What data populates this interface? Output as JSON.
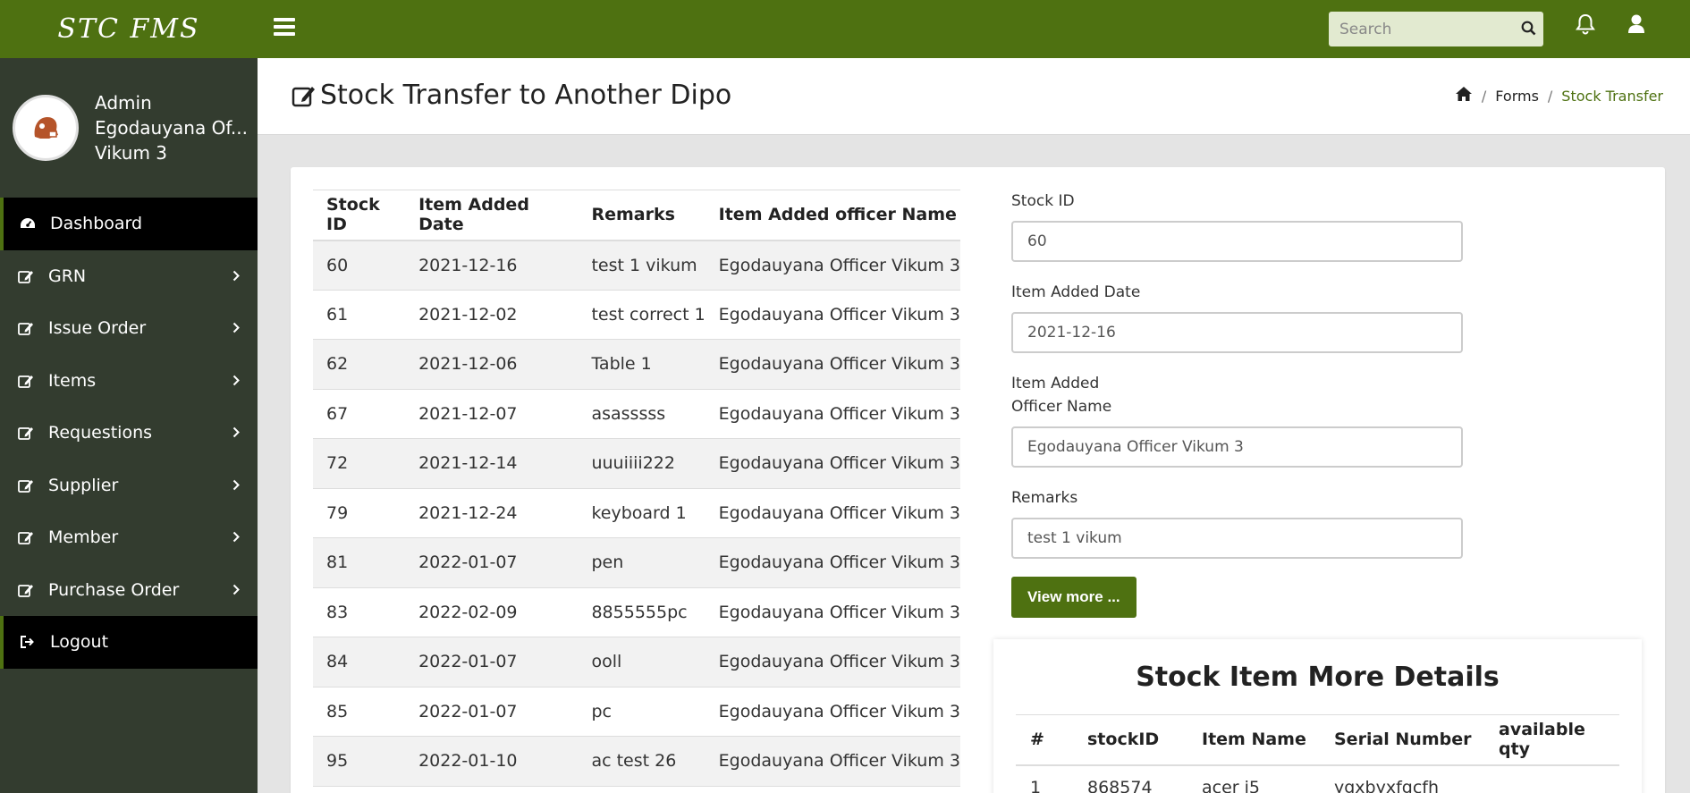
{
  "brand": "STC FMS",
  "user": {
    "line1": "Admin",
    "line2": "Egodauyana Of...",
    "line3": "Vikum 3"
  },
  "nav": [
    {
      "label": "Dashboard"
    },
    {
      "label": "GRN"
    },
    {
      "label": "Issue Order"
    },
    {
      "label": "Items"
    },
    {
      "label": "Requestions"
    },
    {
      "label": "Supplier"
    },
    {
      "label": "Member"
    },
    {
      "label": "Purchase Order"
    },
    {
      "label": "Logout"
    }
  ],
  "search": {
    "placeholder": "Search"
  },
  "page": {
    "title": "Stock Transfer to Another Dipo"
  },
  "breadcrumb": {
    "forms": "Forms",
    "current": "Stock Transfer"
  },
  "stock_table": {
    "headers": [
      "Stock ID",
      "Item Added Date",
      "Remarks",
      "Item Added officer Name"
    ],
    "rows": [
      [
        "60",
        "2021-12-16",
        "test 1 vikum",
        "Egodauyana Officer Vikum 3"
      ],
      [
        "61",
        "2021-12-02",
        "test correct 1",
        "Egodauyana Officer Vikum 3"
      ],
      [
        "62",
        "2021-12-06",
        "Table 1",
        "Egodauyana Officer Vikum 3"
      ],
      [
        "67",
        "2021-12-07",
        "asasssss",
        "Egodauyana Officer Vikum 3"
      ],
      [
        "72",
        "2021-12-14",
        "uuuiiii222",
        "Egodauyana Officer Vikum 3"
      ],
      [
        "79",
        "2021-12-24",
        "keyboard 1",
        "Egodauyana Officer Vikum 3"
      ],
      [
        "81",
        "2022-01-07",
        "pen",
        "Egodauyana Officer Vikum 3"
      ],
      [
        "83",
        "2022-02-09",
        "8855555pc",
        "Egodauyana Officer Vikum 3"
      ],
      [
        "84",
        "2022-01-07",
        "ooll",
        "Egodauyana Officer Vikum 3"
      ],
      [
        "85",
        "2022-01-07",
        "pc",
        "Egodauyana Officer Vikum 3"
      ],
      [
        "95",
        "2022-01-10",
        "ac test 26",
        "Egodauyana Officer Vikum 3"
      ]
    ]
  },
  "form": {
    "stock_id_label": "Stock ID",
    "stock_id_value": "60",
    "date_label": "Item Added Date",
    "date_value": "2021-12-16",
    "officer_label_1": "Item Added",
    "officer_label_2": "Officer Name",
    "officer_value": "Egodauyana Officer Vikum 3",
    "remarks_label": "Remarks",
    "remarks_value": "test 1 vikum",
    "view_more": "View more ..."
  },
  "details": {
    "title": "Stock Item More Details",
    "headers": [
      "#",
      "stockID",
      "Item Name",
      "Serial Number",
      "available qty"
    ],
    "rows": [
      [
        "1",
        "868574",
        "acer i5",
        "ygxbyxfgcfh",
        ""
      ]
    ]
  },
  "colors": {
    "primary": "#4e7111",
    "sidebar": "#333c2f",
    "active_nav": "#000000"
  },
  "icons": {
    "nav": "edit-icon",
    "dashboard": "dashboard-icon",
    "logout": "sign-out-icon"
  }
}
